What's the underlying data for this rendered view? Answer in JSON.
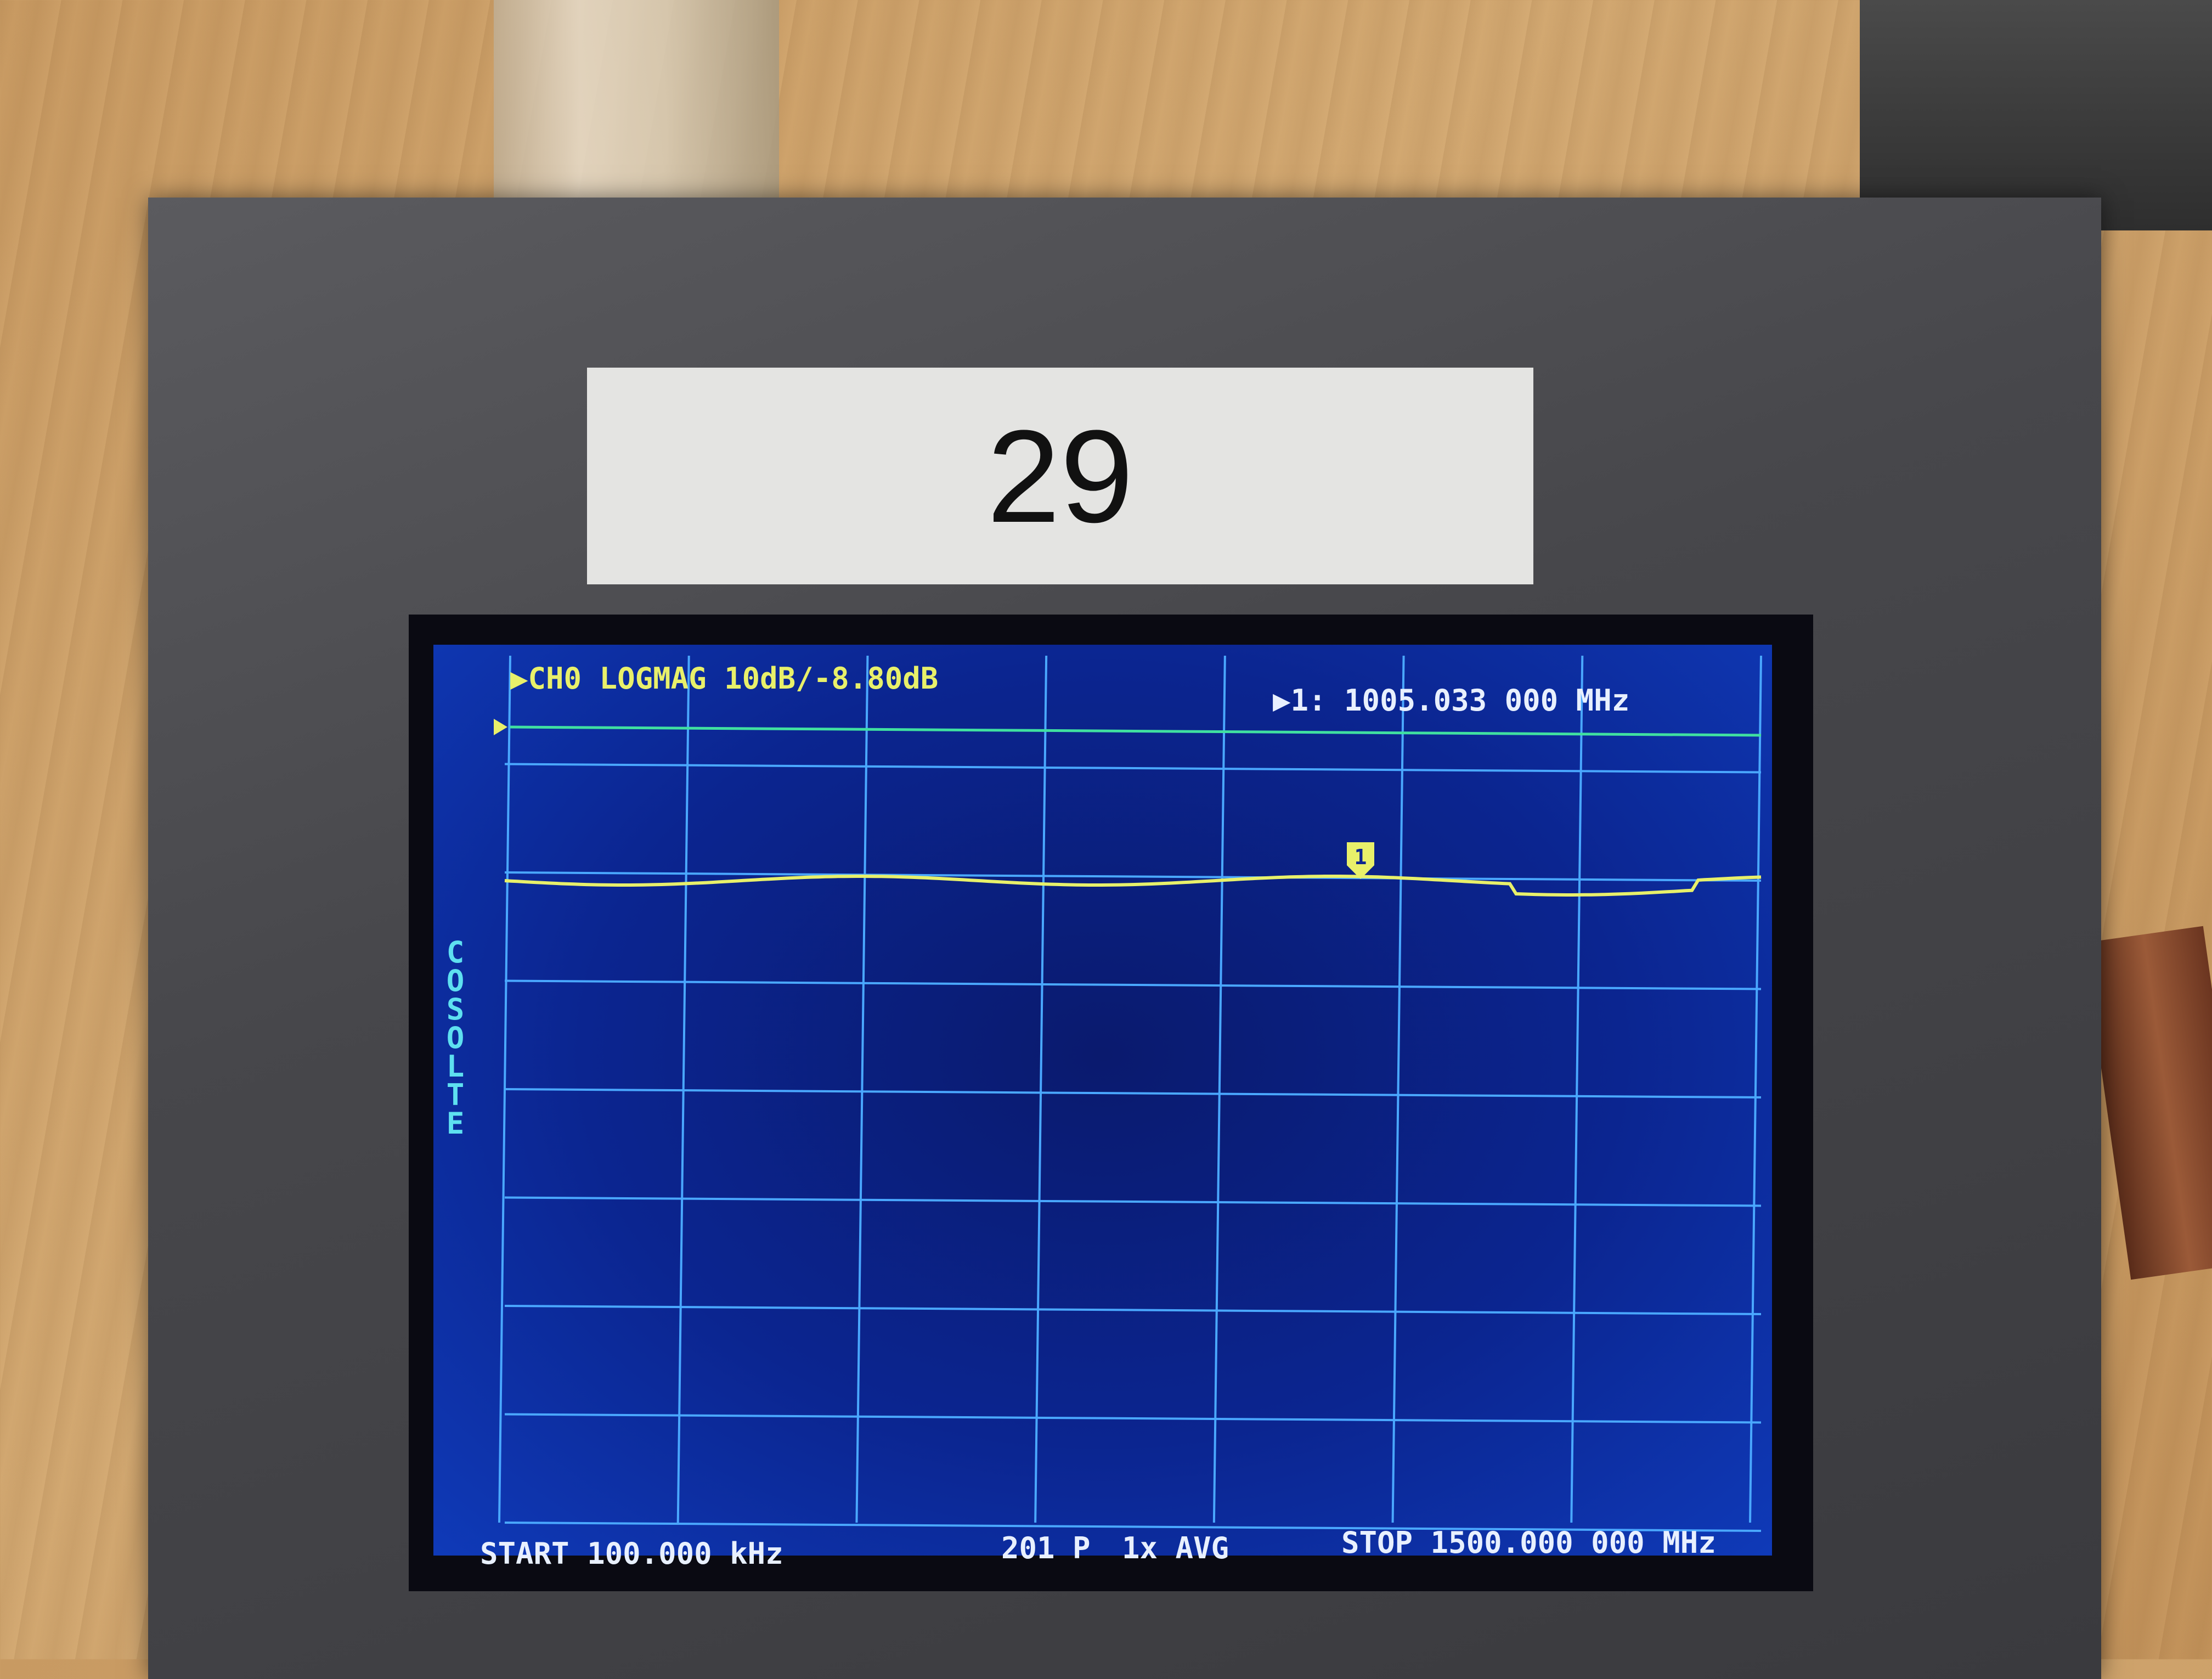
{
  "label_number": "29",
  "screen": {
    "header": "▶CH0 LOGMAG 10dB/-8.80dB",
    "marker_readout": "▶1: 1005.033 000 MHz",
    "marker_id": "1",
    "cal_status": "COSOLTE",
    "footer_start": "START 100.000 kHz",
    "footer_points": "201 P",
    "footer_avg": "1x AVG",
    "footer_stop": "STOP 1500.000 000 MHz"
  },
  "colors": {
    "screen_bg": "#0b2590",
    "trace": "#e8f06a",
    "grid": "#4aa8ff",
    "reference_line": "#40e0a0"
  }
}
